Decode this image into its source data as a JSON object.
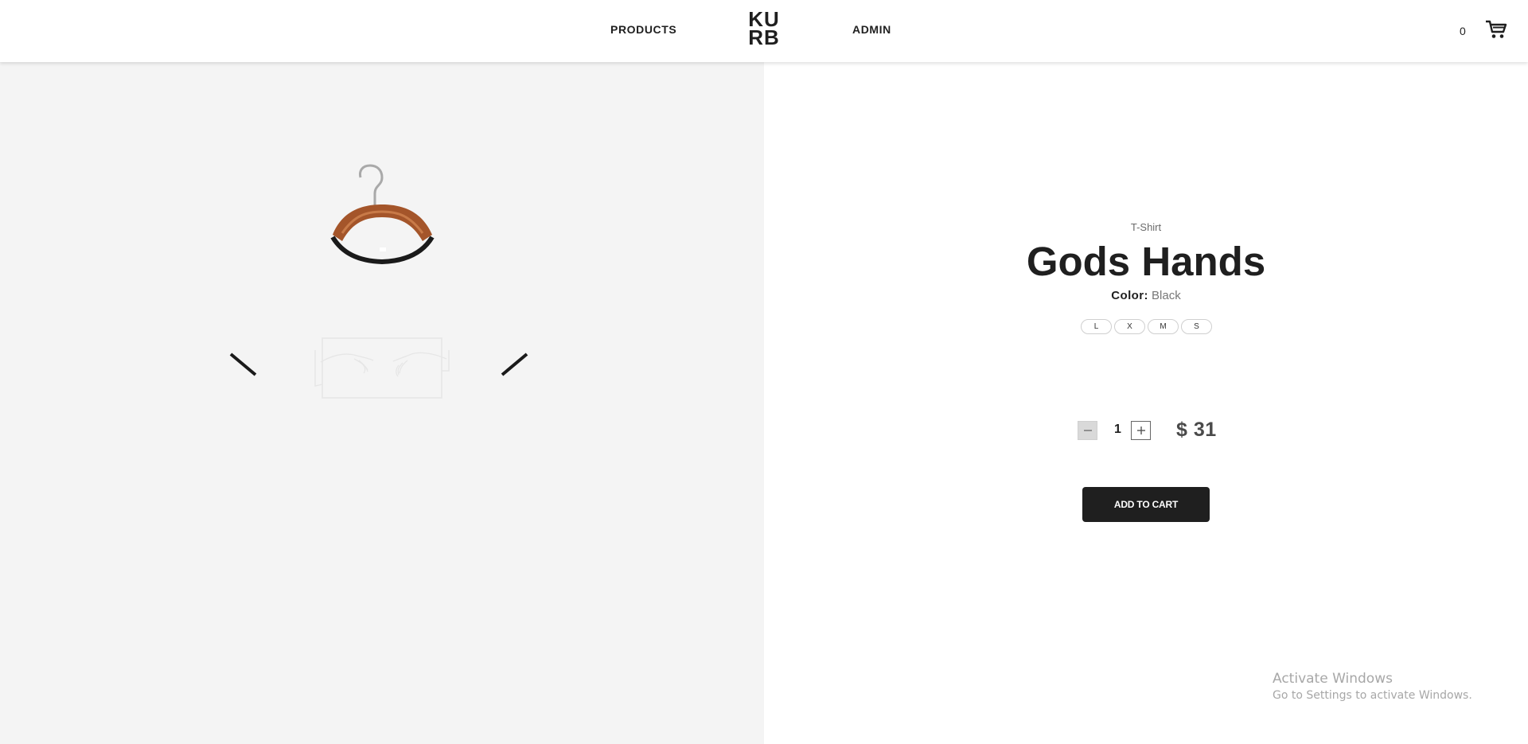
{
  "nav": {
    "products": "PRODUCTS",
    "logo_top": "KU",
    "logo_bottom": "RB",
    "admin": "ADMIN",
    "cart_count": "0"
  },
  "product": {
    "category": "T-Shirt",
    "title": "Gods Hands",
    "color_label": "Color:",
    "color_value": "Black",
    "sizes": [
      "L",
      "X",
      "M",
      "S"
    ],
    "quantity": "1",
    "price": "$ 31",
    "add_to_cart": "ADD TO CART"
  },
  "watermark": {
    "title": "Activate Windows",
    "subtitle": "Go to Settings to activate Windows."
  },
  "icons": {
    "cart": "cart-icon",
    "minus": "minus-icon",
    "plus": "plus-icon"
  }
}
